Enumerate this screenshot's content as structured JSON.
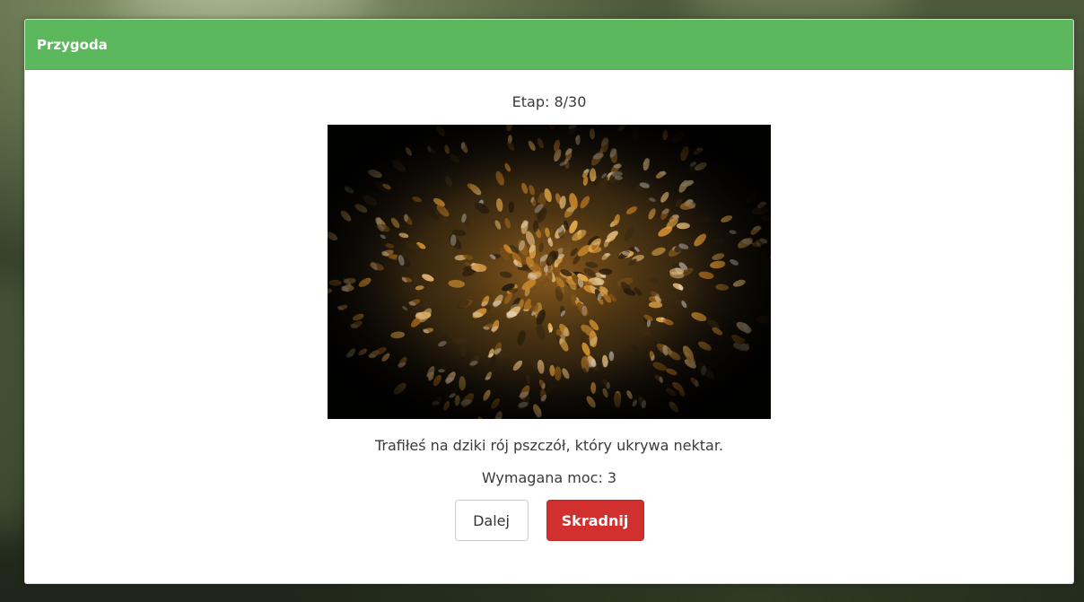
{
  "modal": {
    "title": "Przygoda",
    "stage_label": "Etap: 8/30",
    "image_name": "bee-swarm-image",
    "description": "Trafiłeś na dziki rój pszczół, który ukrywa nektar.",
    "required_power": "Wymagana moc: 3",
    "buttons": {
      "next_label": "Dalej",
      "sneak_label": "Skradnij"
    }
  },
  "colors": {
    "header": "#5cb85c",
    "danger": "#d22f2f"
  }
}
